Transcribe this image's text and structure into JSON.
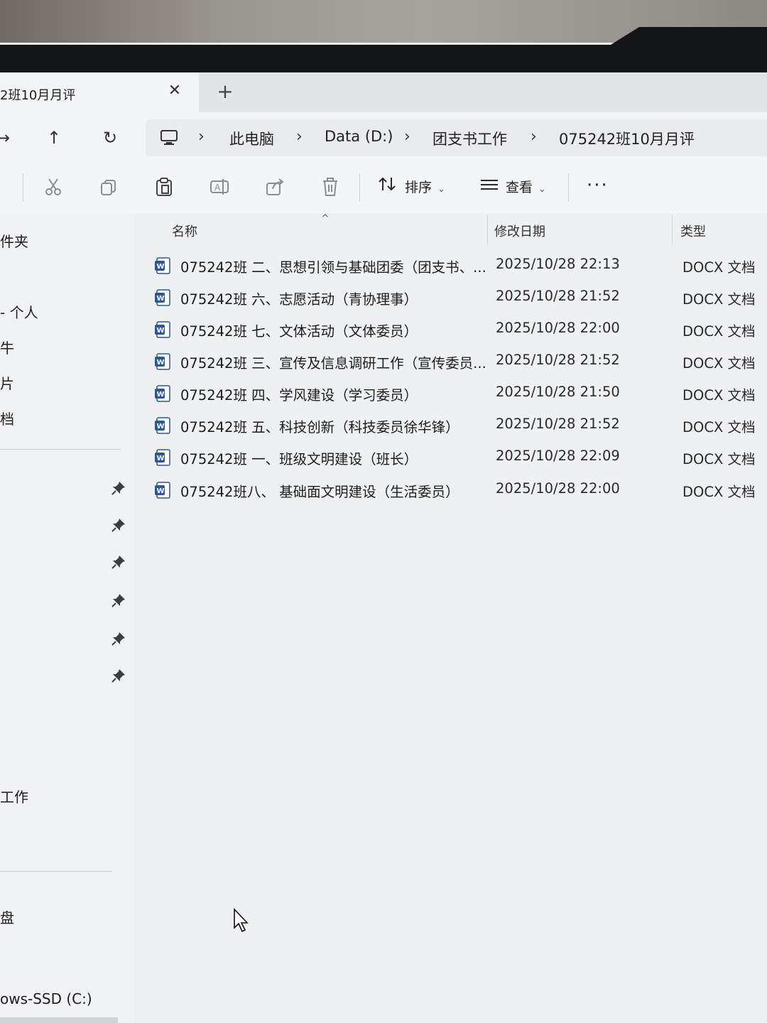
{
  "tab": {
    "title": "2班10月月评",
    "close_glyph": "✕",
    "add_glyph": "+"
  },
  "nav": {
    "back": "→",
    "up": "↑",
    "refresh": "↻",
    "breadcrumbs": [
      "此电脑",
      "Data (D:)",
      "团支书工作",
      "075242班10月月评"
    ],
    "separator": "›"
  },
  "toolbar": {
    "icons": [
      "cut-icon",
      "copy-icon",
      "paste-icon",
      "rename-icon",
      "share-icon",
      "delete-icon"
    ],
    "sort_label": "排序",
    "view_label": "查看",
    "more": "···"
  },
  "sidebar": {
    "items": [
      "件夹",
      "- 个人",
      "牛",
      "片",
      "档",
      "工作",
      "盘",
      "ows-SSD (C:)"
    ]
  },
  "columns": {
    "name": "名称",
    "date": "修改日期",
    "type": "类型",
    "sort_caret": "^"
  },
  "files": [
    {
      "name": "075242班 二、思想引领与基础团委（团支书、...",
      "date": "2025/10/28 22:13",
      "type": "DOCX 文档"
    },
    {
      "name": "075242班 六、志愿活动（青协理事）",
      "date": "2025/10/28 21:52",
      "type": "DOCX 文档"
    },
    {
      "name": "075242班 七、文体活动（文体委员）",
      "date": "2025/10/28 22:00",
      "type": "DOCX 文档"
    },
    {
      "name": "075242班 三、宣传及信息调研工作（宣传委员...",
      "date": "2025/10/28 21:52",
      "type": "DOCX 文档"
    },
    {
      "name": "075242班 四、学风建设（学习委员）",
      "date": "2025/10/28 21:50",
      "type": "DOCX 文档"
    },
    {
      "name": "075242班 五、科技创新（科技委员徐华锋）",
      "date": "2025/10/28 21:52",
      "type": "DOCX 文档"
    },
    {
      "name": "075242班 一、班级文明建设（班长）",
      "date": "2025/10/28 22:09",
      "type": "DOCX 文档"
    },
    {
      "name": "075242班八、 基础面文明建设（生活委员）",
      "date": "2025/10/28 22:00",
      "type": "DOCX 文档"
    }
  ],
  "colors": {
    "word_blue": "#2b579a",
    "accent": "#0067c0"
  }
}
